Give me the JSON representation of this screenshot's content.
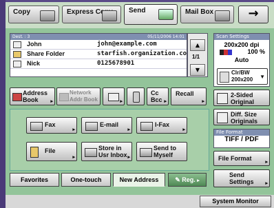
{
  "tabs": [
    {
      "label": "Copy",
      "icon": "copier-icon"
    },
    {
      "label": "Express Copy",
      "icon": "copier-icon"
    },
    {
      "label": "Send",
      "icon": "send-icon"
    },
    {
      "label": "Mail Box",
      "icon": "mailbox-icon"
    }
  ],
  "arrow_button": "→",
  "dest_list": {
    "header_left": "Dest. :   3",
    "header_right": "05/11/2006 14:01",
    "rows": [
      {
        "name": "John",
        "address": "john@example.com",
        "icon": "email-icon"
      },
      {
        "name": "Share Folder",
        "address": "starfish.organization.co",
        "icon": "folder-icon"
      },
      {
        "name": "Nick",
        "address": "0125678901",
        "icon": "fax-icon"
      }
    ],
    "page": "1/1",
    "scroll_up": "▲",
    "scroll_down": "▼"
  },
  "scan_settings": {
    "header": "Scan Settings",
    "resolution": "200x200 dpi",
    "zoom": "100 %",
    "density": "Auto",
    "color_mode": "Clr/BW",
    "color_res": "200x200"
  },
  "toolbar": {
    "address_book": "Address Book",
    "network_book": "Network Addr Book",
    "detail": "",
    "delete": "",
    "cc_bcc": "Cc Bcc",
    "recall": "Recall"
  },
  "right_buttons": {
    "two_sided": "2-Sided Original",
    "diff_size": "Diff. Size Originals",
    "file_format_header": "File Format",
    "file_format_value": "TIFF / PDF",
    "file_format_button": "File Format",
    "send_settings": "Send Settings"
  },
  "send_types": {
    "fax": "Fax",
    "email": "E-mail",
    "ifax": "I-Fax",
    "file": "File",
    "store": "Store in Usr Inbox",
    "send_myself": "Send to Myself"
  },
  "bottom_tabs": {
    "favorites": "Favorites",
    "one_touch": "One-touch",
    "new_address": "New Address",
    "reg": "Reg."
  },
  "system_monitor": "System Monitor"
}
